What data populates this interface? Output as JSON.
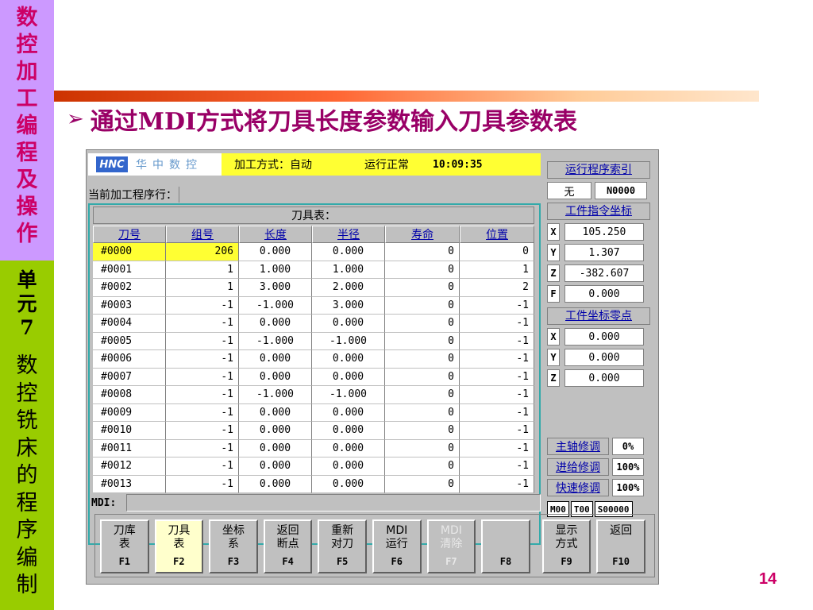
{
  "sidebar": {
    "title_chars": [
      "数",
      "控",
      "加",
      "工",
      "编",
      "程",
      "及",
      "操",
      "作"
    ],
    "unit_chars": [
      "单",
      "元",
      "7"
    ],
    "unit_name_chars": [
      "数",
      "控",
      "铣",
      "床",
      "的",
      "程",
      "序",
      "编",
      "制"
    ]
  },
  "heading": {
    "arrow": "➢",
    "text": "通过MDI方式将刀具长度参数输入刀具参数表"
  },
  "page_number": "14",
  "screen": {
    "logo_text": "HNC",
    "brand": "华中数控",
    "mode_label": "加工方式：",
    "mode_value": "自动",
    "run_status": "运行正常",
    "clock": "10:09:35",
    "current_program_label": "当前加工程序行：",
    "table_title": "刀具表：",
    "columns": [
      "刀号",
      "组号",
      "长度",
      "半径",
      "寿命",
      "位置"
    ],
    "rows": [
      {
        "tool": "#0000",
        "group": "206",
        "length": "0.000",
        "radius": "0.000",
        "life": "0",
        "pos": "0"
      },
      {
        "tool": "#0001",
        "group": "1",
        "length": "1.000",
        "radius": "1.000",
        "life": "0",
        "pos": "1"
      },
      {
        "tool": "#0002",
        "group": "1",
        "length": "3.000",
        "radius": "2.000",
        "life": "0",
        "pos": "2"
      },
      {
        "tool": "#0003",
        "group": "-1",
        "length": "-1.000",
        "radius": "3.000",
        "life": "0",
        "pos": "-1"
      },
      {
        "tool": "#0004",
        "group": "-1",
        "length": "0.000",
        "radius": "0.000",
        "life": "0",
        "pos": "-1"
      },
      {
        "tool": "#0005",
        "group": "-1",
        "length": "-1.000",
        "radius": "-1.000",
        "life": "0",
        "pos": "-1"
      },
      {
        "tool": "#0006",
        "group": "-1",
        "length": "0.000",
        "radius": "0.000",
        "life": "0",
        "pos": "-1"
      },
      {
        "tool": "#0007",
        "group": "-1",
        "length": "0.000",
        "radius": "0.000",
        "life": "0",
        "pos": "-1"
      },
      {
        "tool": "#0008",
        "group": "-1",
        "length": "-1.000",
        "radius": "-1.000",
        "life": "0",
        "pos": "-1"
      },
      {
        "tool": "#0009",
        "group": "-1",
        "length": "0.000",
        "radius": "0.000",
        "life": "0",
        "pos": "-1"
      },
      {
        "tool": "#0010",
        "group": "-1",
        "length": "0.000",
        "radius": "0.000",
        "life": "0",
        "pos": "-1"
      },
      {
        "tool": "#0011",
        "group": "-1",
        "length": "0.000",
        "radius": "0.000",
        "life": "0",
        "pos": "-1"
      },
      {
        "tool": "#0012",
        "group": "-1",
        "length": "0.000",
        "radius": "0.000",
        "life": "0",
        "pos": "-1"
      },
      {
        "tool": "#0013",
        "group": "-1",
        "length": "0.000",
        "radius": "0.000",
        "life": "0",
        "pos": "-1"
      }
    ],
    "selected_row": 0,
    "mdi_label": "MDI:",
    "right": {
      "program_index_header": "运行程序索引",
      "program_none": "无",
      "program_number": "N0000",
      "workpiece_cmd_header": "工件指令坐标",
      "cmd_x": "105.250",
      "cmd_y": "1.307",
      "cmd_z": "-382.607",
      "cmd_f": "0.000",
      "work_zero_header": "工件坐标零点",
      "zero_x": "0.000",
      "zero_y": "0.000",
      "zero_z": "0.000",
      "axis_x": "X",
      "axis_y": "Y",
      "axis_z": "Z",
      "axis_f": "F",
      "spindle_label": "主轴修调",
      "spindle_value": "0%",
      "feed_label": "进给修调",
      "feed_value": "100%",
      "rapid_label": "快速修调",
      "rapid_value": "100%",
      "m_code": "M00",
      "t_code": "T00",
      "s_code": "S00000"
    },
    "fkeys": [
      {
        "line1": "刀库",
        "line2": "表",
        "num": "F1"
      },
      {
        "line1": "刀具",
        "line2": "表",
        "num": "F2"
      },
      {
        "line1": "坐标",
        "line2": "系",
        "num": "F3"
      },
      {
        "line1": "返回",
        "line2": "断点",
        "num": "F4"
      },
      {
        "line1": "重新",
        "line2": "对刀",
        "num": "F5"
      },
      {
        "line1": "MDI",
        "line2": "运行",
        "num": "F6"
      },
      {
        "line1": "MDI",
        "line2": "清除",
        "num": "F7"
      },
      {
        "line1": "",
        "line2": "",
        "num": "F8"
      },
      {
        "line1": "显示",
        "line2": "方式",
        "num": "F9"
      },
      {
        "line1": "返回",
        "line2": "",
        "num": "F10"
      }
    ],
    "active_fkey": 1,
    "disabled_fkey": 6
  }
}
